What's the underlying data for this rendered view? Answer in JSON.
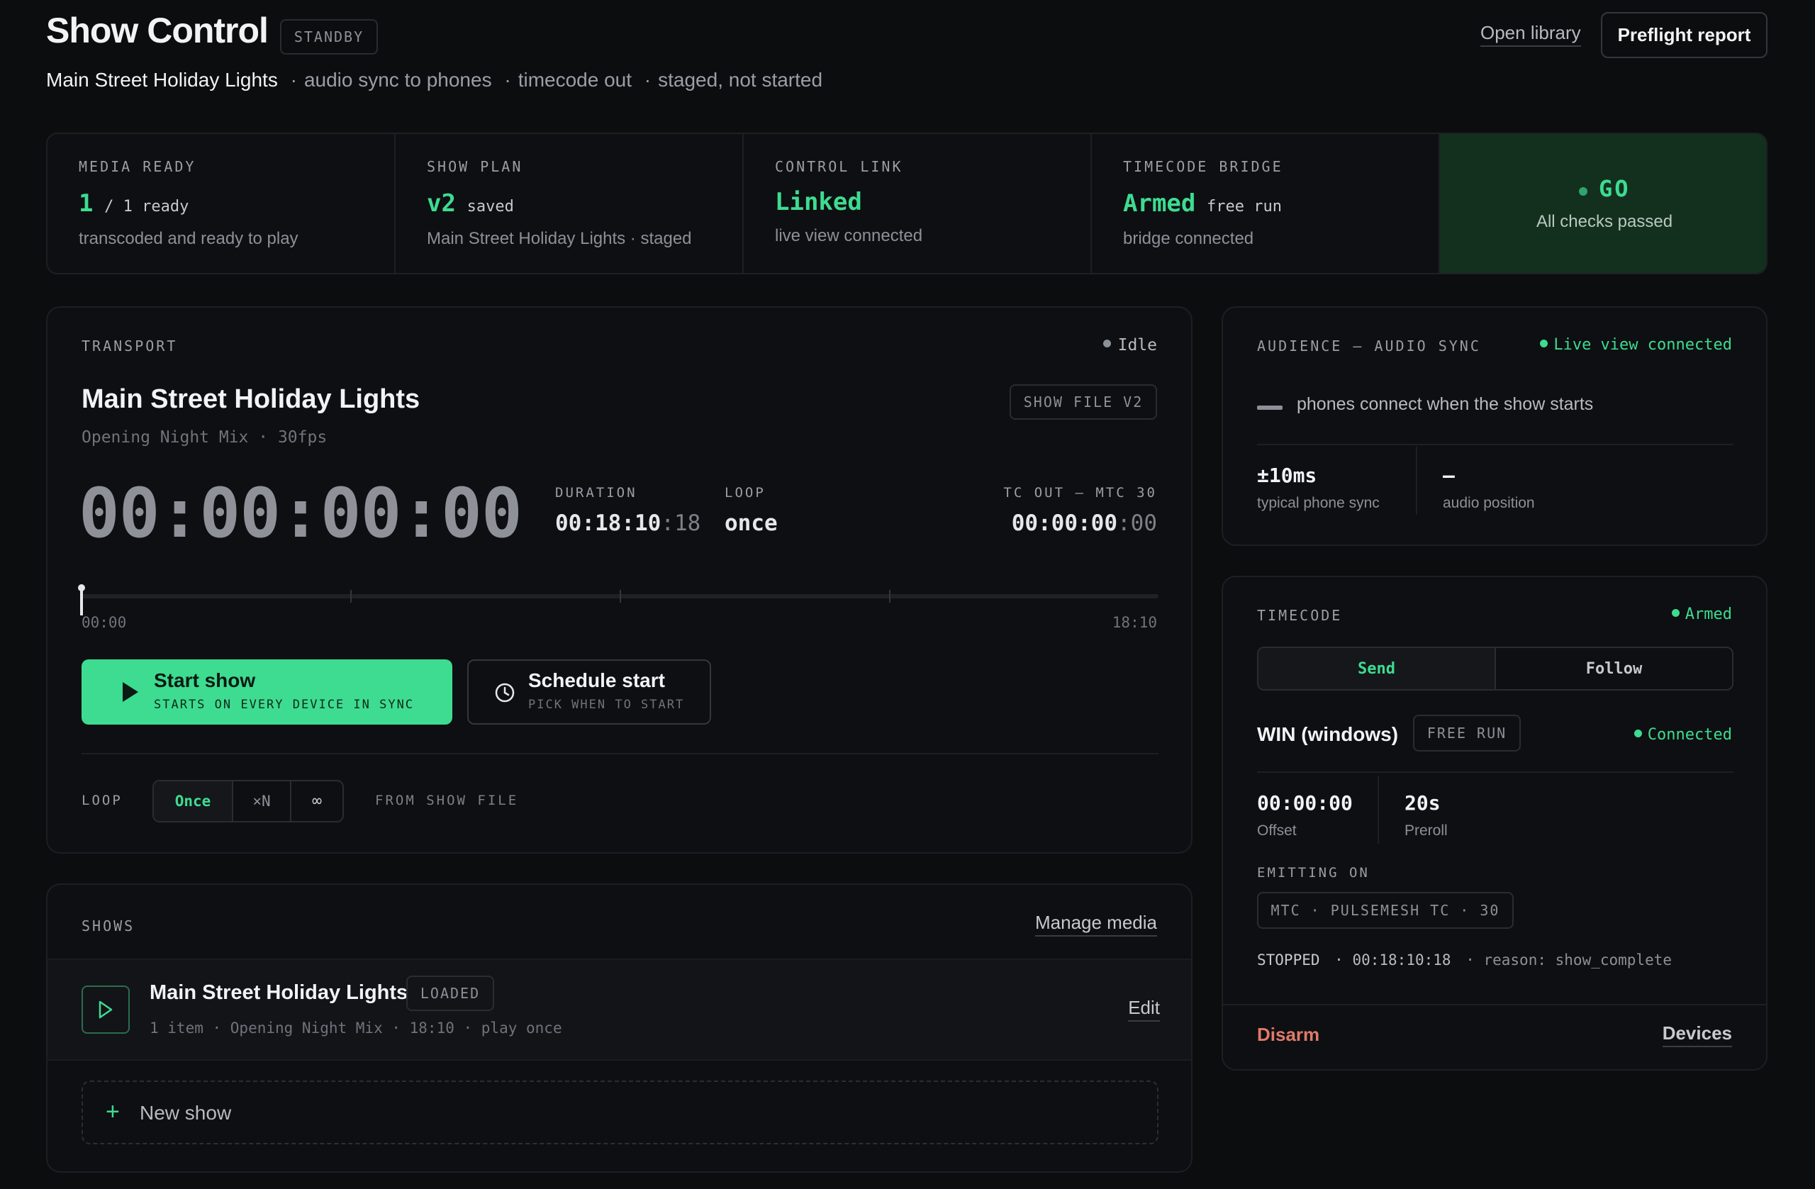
{
  "header": {
    "title": "Show Control",
    "status_badge": "STANDBY",
    "show_name": "Main Street Holiday Lights",
    "meta": [
      "audio sync to phones",
      "timecode out",
      "staged, not started"
    ],
    "open_library": "Open library",
    "preflight_report": "Preflight report"
  },
  "status_strip": [
    {
      "label": "MEDIA READY",
      "value": "1",
      "value_suffix": "/ 1 ready",
      "sub": "transcoded and ready to play"
    },
    {
      "label": "SHOW PLAN",
      "value": "v2",
      "value_suffix": "saved",
      "sub": "Main Street Holiday Lights · staged"
    },
    {
      "label": "CONTROL LINK",
      "value": "Linked",
      "value_suffix": "",
      "sub": "live view connected"
    },
    {
      "label": "TIMECODE BRIDGE",
      "value": "Armed",
      "value_suffix": "free run",
      "sub": "bridge connected"
    }
  ],
  "go": {
    "label": "GO",
    "sub": "All checks passed"
  },
  "transport": {
    "label": "TRANSPORT",
    "state": "Idle",
    "show_title": "Main Street Holiday Lights",
    "show_sub": "Opening Night Mix · 30fps",
    "show_file": "SHOW FILE V2",
    "timecode": "00:00:00:00",
    "duration_label": "DURATION",
    "duration_main": "00:18:10",
    "duration_frames": ":18",
    "loop_label": "LOOP",
    "loop_value": "once",
    "tc_out_label": "TC OUT — MTC 30",
    "tc_out_main": "00:00:00",
    "tc_out_frames": ":00",
    "progress": 0,
    "scrub_start": "00:00",
    "scrub_end": "18:10",
    "start_show": "Start show",
    "start_show_sub": "STARTS ON EVERY DEVICE IN SYNC",
    "schedule_start": "Schedule start",
    "schedule_start_sub": "PICK WHEN TO START",
    "loop_row_label": "LOOP",
    "loop_options": [
      "Once",
      "×N",
      "∞"
    ],
    "loop_selected": "Once",
    "from_show_file": "FROM SHOW FILE"
  },
  "shows": {
    "label": "SHOWS",
    "manage_media": "Manage media",
    "items": [
      {
        "name": "Main Street Holiday Lights",
        "badge": "LOADED",
        "meta": "1 item · Opening Night Mix · 18:10 · play once",
        "edit": "Edit"
      }
    ],
    "new_show": "New show"
  },
  "audience": {
    "label": "AUDIENCE — AUDIO SYNC",
    "status": "Live view connected",
    "message": "phones connect when the show starts",
    "stat1_value": "±10ms",
    "stat1_label": "typical phone sync",
    "stat2_value": "—",
    "stat2_label": "audio position"
  },
  "timecode_panel": {
    "label": "TIMECODE",
    "status": "Armed",
    "tabs": [
      "Send",
      "Follow"
    ],
    "tab_selected": "Send",
    "device": "WIN (windows)",
    "device_badge": "FREE RUN",
    "device_status": "Connected",
    "offset_value": "00:00:00",
    "offset_label": "Offset",
    "preroll_value": "20s",
    "preroll_label": "Preroll",
    "emitting_label": "EMITTING ON",
    "emitting_value": "MTC · PULSEMESH TC · 30",
    "log_state": "STOPPED",
    "log_tc": "· 00:18:10:18",
    "log_reason": "· reason: show_complete",
    "disarm": "Disarm",
    "devices": "Devices"
  },
  "colors": {
    "accent": "#3ddc91",
    "danger": "#e07a6a",
    "go_bg": "#13301f"
  }
}
